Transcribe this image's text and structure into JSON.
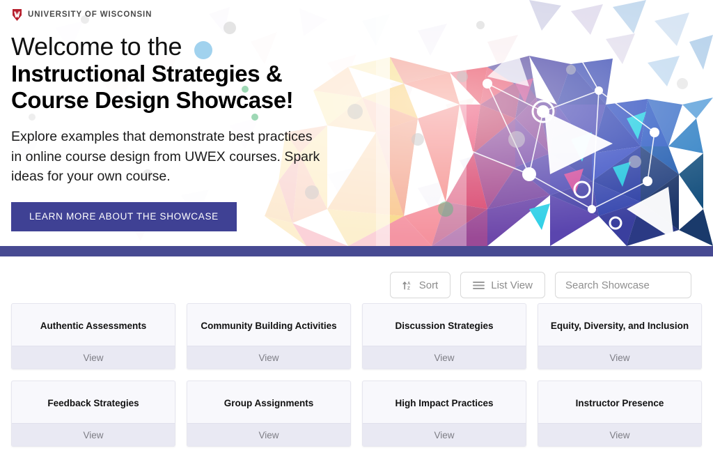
{
  "brand": {
    "wordmark": "UNIVERSITY OF WISCONSIN",
    "crest_icon": "uw-crest-icon",
    "crest_color": "#b7202e"
  },
  "hero": {
    "title_line1": "Welcome to the",
    "title_line2": "Instructional Strategies &",
    "title_line3": "Course Design Showcase!",
    "description": "Explore examples that demonstrate best practices in online course design from UWEX courses. Spark ideas for your own course.",
    "cta_label": "LEARN MORE ABOUT THE SHOWCASE",
    "cta_color": "#3f4194",
    "divider_color": "#474a92"
  },
  "toolbar": {
    "sort_label": "Sort",
    "sort_icon": "sort-alpha-asc-icon",
    "view_label": "List View",
    "view_icon": "list-lines-icon",
    "search_placeholder": "Search Showcase",
    "search_value": ""
  },
  "cards": [
    {
      "title": "Authentic Assessments",
      "action": "View"
    },
    {
      "title": "Community Building Activities",
      "action": "View"
    },
    {
      "title": "Discussion Strategies",
      "action": "View"
    },
    {
      "title": "Equity, Diversity, and Inclusion",
      "action": "View"
    },
    {
      "title": "Feedback Strategies",
      "action": "View"
    },
    {
      "title": "Group Assignments",
      "action": "View"
    },
    {
      "title": "High Impact Practices",
      "action": "View"
    },
    {
      "title": "Instructor Presence",
      "action": "View"
    }
  ]
}
